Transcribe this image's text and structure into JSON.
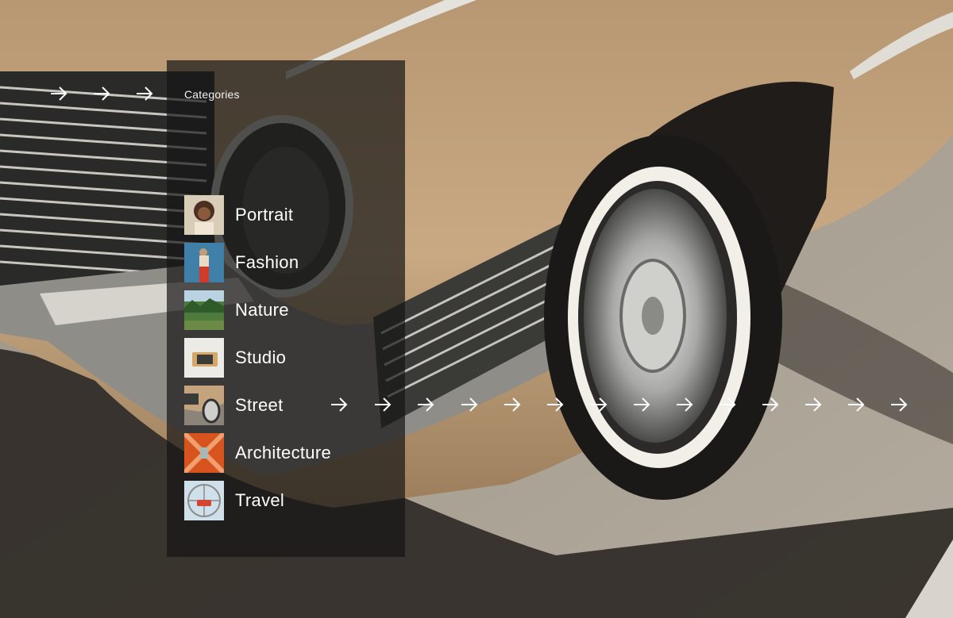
{
  "panel": {
    "title": "Categories"
  },
  "categories": [
    {
      "label": "Portrait",
      "icon": "portrait-thumbnail"
    },
    {
      "label": "Fashion",
      "icon": "fashion-thumbnail"
    },
    {
      "label": "Nature",
      "icon": "nature-thumbnail"
    },
    {
      "label": "Studio",
      "icon": "studio-thumbnail"
    },
    {
      "label": "Street",
      "icon": "street-thumbnail"
    },
    {
      "label": "Architecture",
      "icon": "architecture-thumbnail"
    },
    {
      "label": "Travel",
      "icon": "travel-thumbnail"
    }
  ],
  "arrows": {
    "icon": "arrow-right-icon",
    "top_row_count": 3,
    "street_row_count": 14
  },
  "colors": {
    "panel_overlay": "#161616",
    "text": "#ffffff",
    "car_body": "#c4a47f",
    "asphalt": "#8d857a"
  }
}
